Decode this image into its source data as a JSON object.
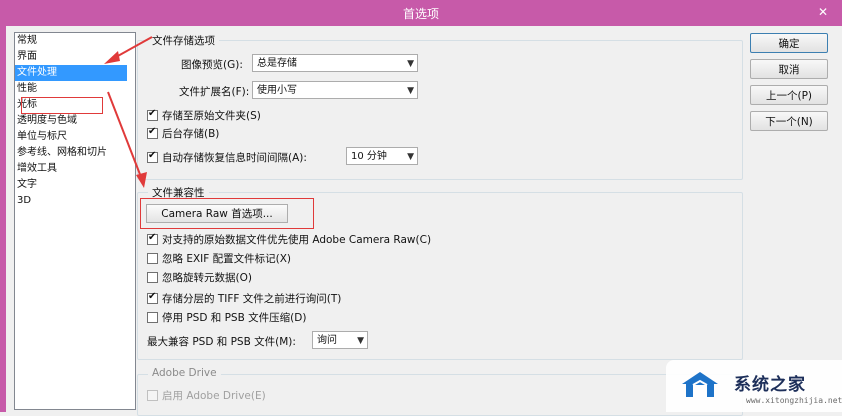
{
  "window": {
    "title": "首选项",
    "close_glyph": "✕"
  },
  "sidebar": {
    "items": [
      {
        "label": "常规"
      },
      {
        "label": "界面"
      },
      {
        "label": "文件处理",
        "selected": true
      },
      {
        "label": "性能"
      },
      {
        "label": "光标"
      },
      {
        "label": "透明度与色域"
      },
      {
        "label": "单位与标尺"
      },
      {
        "label": "参考线、网格和切片"
      },
      {
        "label": "增效工具"
      },
      {
        "label": "文字"
      },
      {
        "label": "3D"
      }
    ]
  },
  "file_save": {
    "title": "文件存储选项",
    "image_preview_label": "图像预览(G):",
    "image_preview_value": "总是存储",
    "extension_label": "文件扩展名(F):",
    "extension_value": "使用小写",
    "save_as_original": {
      "label": "存储至原始文件夹(S)",
      "checked": true
    },
    "background_save": {
      "label": "后台存储(B)",
      "checked": true
    },
    "autosave": {
      "label": "自动存储恢复信息时间间隔(A):",
      "checked": true
    },
    "autosave_interval": "10 分钟"
  },
  "compat": {
    "title": "文件兼容性",
    "camera_raw_button": "Camera Raw 首选项...",
    "prefer_acr": {
      "label": "对支持的原始数据文件优先使用 Adobe Camera Raw(C)",
      "checked": true
    },
    "ignore_exif": {
      "label": "忽略 EXIF 配置文件标记(X)",
      "checked": false
    },
    "ignore_rotation": {
      "label": "忽略旋转元数据(O)",
      "checked": false
    },
    "ask_tiff": {
      "label": "存储分层的 TIFF 文件之前进行询问(T)",
      "checked": true
    },
    "disable_compression": {
      "label": "停用 PSD 和 PSB 文件压缩(D)",
      "checked": false
    },
    "max_compat_label": "最大兼容 PSD 和 PSB 文件(M):",
    "max_compat_value": "询问"
  },
  "adobe_drive": {
    "title": "Adobe Drive",
    "enable": {
      "label": "启用 Adobe Drive(E)",
      "checked": false
    }
  },
  "buttons": {
    "ok": "确定",
    "cancel": "取消",
    "prev": "上一个(P)",
    "next": "下一个(N)"
  },
  "watermark": {
    "text": "系统之家",
    "url": "www.xitongzhijia.net"
  },
  "colors": {
    "titlebar": "#c75aa9",
    "selection": "#3399ff",
    "annotation_red": "#e03a3a"
  },
  "icons": {
    "dropdown": "chevron-down-icon",
    "check": "check-icon",
    "close": "close-icon"
  }
}
